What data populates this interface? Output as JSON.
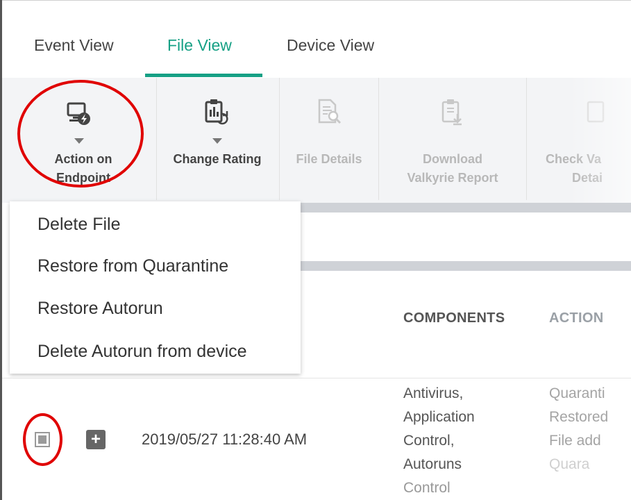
{
  "tabs": [
    {
      "label": "Event View",
      "active": false
    },
    {
      "label": "File View",
      "active": true
    },
    {
      "label": "Device View",
      "active": false
    }
  ],
  "toolbar": {
    "action_on_endpoint": {
      "line1": "Action on",
      "line2": "Endpoint",
      "icon": "monitor-bolt-icon"
    },
    "change_rating": {
      "label": "Change Rating",
      "icon": "clipboard-chart-icon"
    },
    "file_details": {
      "label": "File Details",
      "icon": "file-search-icon"
    },
    "download_valkyrie_report": {
      "line1": "Download",
      "line2": "Valkyrie Report",
      "icon": "clipboard-download-icon"
    },
    "check_valkyrie_details": {
      "line1": "Check Va",
      "line2": "Detai"
    }
  },
  "dropdown": {
    "items": [
      "Delete File",
      "Restore from Quarantine",
      "Restore Autorun",
      "Delete Autorun from device"
    ]
  },
  "table": {
    "headers": [
      "COMPONENTS",
      "ACTION"
    ],
    "row": {
      "timestamp": "2019/05/27 11:28:40 AM",
      "components": [
        "Antivirus,",
        "Application",
        "Control,",
        "Autoruns",
        "Control"
      ],
      "action": [
        "Quaranti",
        "Restored",
        "File add",
        "Quara"
      ]
    }
  },
  "colors": {
    "accent": "#16a085",
    "highlight": "#e00000"
  }
}
